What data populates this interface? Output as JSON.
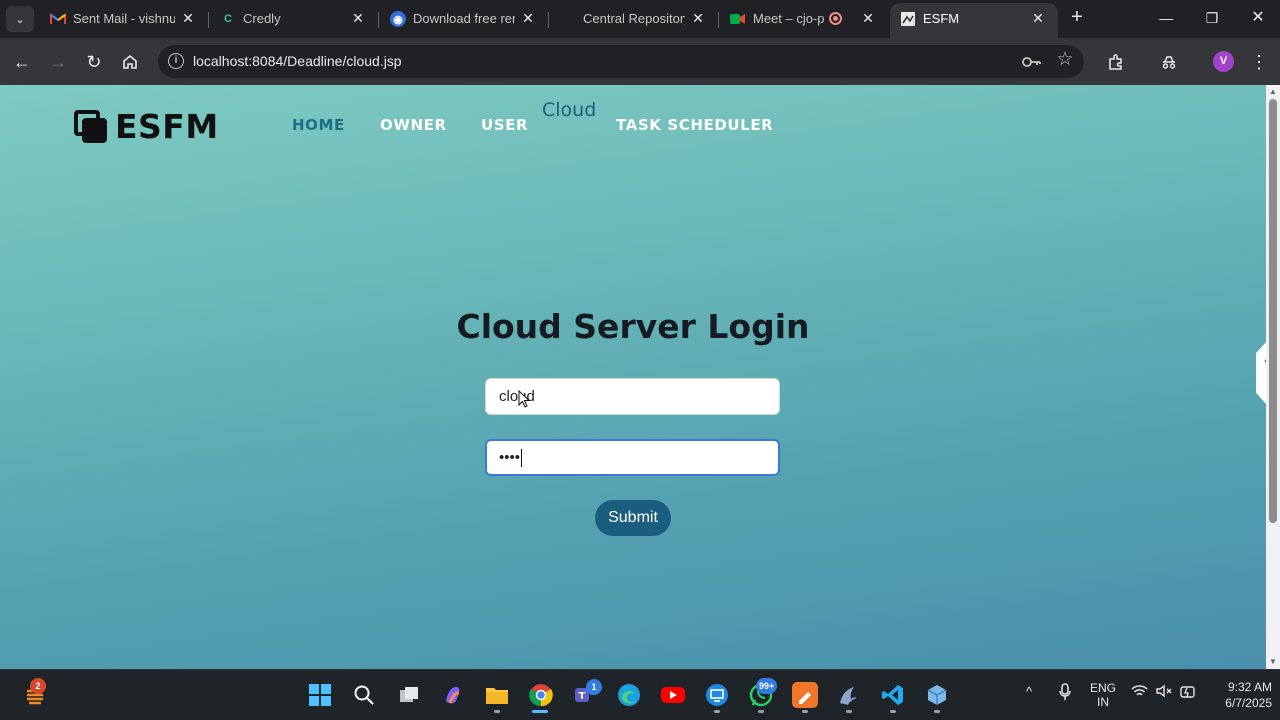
{
  "browser": {
    "tabs": [
      {
        "title": "Sent Mail - vishnu",
        "favicon": "gmail-icon",
        "active": false
      },
      {
        "title": "Credly",
        "favicon": "credly-icon",
        "active": false
      },
      {
        "title": "Download free ren",
        "favicon": "download-site-icon",
        "active": false
      },
      {
        "title": "Central Repository",
        "favicon": "none",
        "active": false
      },
      {
        "title": "Meet – cjo-pev",
        "favicon": "meet-icon",
        "active": false
      },
      {
        "title": "ESFM",
        "favicon": "esfm-icon",
        "active": true
      }
    ],
    "url": "localhost:8084/Deadline/cloud.jsp",
    "profile_initial": "V"
  },
  "page": {
    "logo_text": "ESFM",
    "nav": [
      {
        "label": "HOME",
        "active": true
      },
      {
        "label": "OWNER",
        "active": false
      },
      {
        "label": "USER",
        "active": false
      },
      {
        "label": "Cloud",
        "active": false
      },
      {
        "label": "TASK SCHEDULER",
        "active": false
      }
    ],
    "login": {
      "title": "Cloud Server Login",
      "username_value": "cloud",
      "password_masked": "••••",
      "submit_label": "Submit"
    },
    "colors": {
      "gradient_top": "#7fcac2",
      "gradient_bottom": "#4a8fac",
      "active_nav": "#1d6f86",
      "submit_button": "#1a5d7f"
    }
  },
  "taskbar": {
    "widget_badge": "2",
    "teams_badge": "1",
    "whatsapp_badge": "99+",
    "lang_line1": "ENG",
    "lang_line2": "IN",
    "time": "9:32 AM",
    "date": "6/7/2025"
  }
}
